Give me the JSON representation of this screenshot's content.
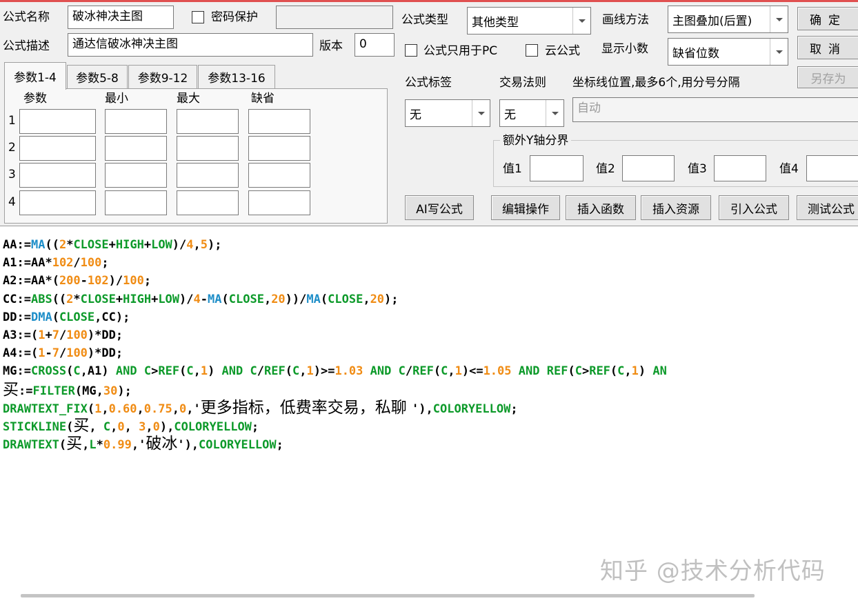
{
  "header": {
    "name_label": "公式名称",
    "name_value": "破冰神决主图",
    "password_label": "密码保护",
    "desc_label": "公式描述",
    "desc_value": "通达信破冰神决主图",
    "version_label": "版本",
    "version_value": "0",
    "type_label": "公式类型",
    "type_value": "其他类型",
    "draw_label": "画线方法",
    "draw_value": "主图叠加(后置)",
    "pc_only_label": "公式只用于PC",
    "cloud_label": "云公式",
    "decimals_label": "显示小数",
    "decimals_value": "缺省位数"
  },
  "buttons": {
    "ok": "确定",
    "cancel": "取消",
    "save_as": "另存为",
    "ai_write": "AI写公式",
    "edit_ops": "编辑操作",
    "insert_func": "插入函数",
    "insert_res": "插入资源",
    "import_formula": "引入公式",
    "test_formula": "测试公式"
  },
  "tabs": [
    {
      "label": "参数1-4",
      "active": true
    },
    {
      "label": "参数5-8",
      "active": false
    },
    {
      "label": "参数9-12",
      "active": false
    },
    {
      "label": "参数13-16",
      "active": false
    }
  ],
  "params": {
    "headers": [
      "参数",
      "最小",
      "最大",
      "缺省"
    ],
    "rows": [
      "1",
      "2",
      "3",
      "4"
    ]
  },
  "right_panel": {
    "tag_label": "公式标签",
    "tag_value": "无",
    "rule_label": "交易法则",
    "rule_value": "无",
    "axis_label": "坐标线位置,最多6个,用分号分隔",
    "axis_value": "自动",
    "extra_y_title": "额外Y轴分界",
    "val1_label": "值1",
    "val2_label": "值2",
    "val3_label": "值3",
    "val4_label": "值4"
  },
  "code_lines": [
    [
      [
        "var",
        "AA"
      ],
      [
        "op",
        ":="
      ],
      [
        "fn",
        "MA"
      ],
      [
        "op",
        "(("
      ],
      [
        "num",
        "2"
      ],
      [
        "op",
        "*"
      ],
      [
        "kw",
        "CLOSE"
      ],
      [
        "op",
        "+"
      ],
      [
        "kw",
        "HIGH"
      ],
      [
        "op",
        "+"
      ],
      [
        "kw",
        "LOW"
      ],
      [
        "op",
        ")/"
      ],
      [
        "num",
        "4"
      ],
      [
        "op",
        ","
      ],
      [
        "num",
        "5"
      ],
      [
        "op",
        ");"
      ]
    ],
    [
      [
        "var",
        "A1"
      ],
      [
        "op",
        ":="
      ],
      [
        "var",
        "AA"
      ],
      [
        "op",
        "*"
      ],
      [
        "num",
        "102"
      ],
      [
        "op",
        "/"
      ],
      [
        "num",
        "100"
      ],
      [
        "op",
        ";"
      ]
    ],
    [
      [
        "var",
        "A2"
      ],
      [
        "op",
        ":="
      ],
      [
        "var",
        "AA"
      ],
      [
        "op",
        "*("
      ],
      [
        "num",
        "200"
      ],
      [
        "op",
        "-"
      ],
      [
        "num",
        "102"
      ],
      [
        "op",
        ")/"
      ],
      [
        "num",
        "100"
      ],
      [
        "op",
        ";"
      ]
    ],
    [
      [
        "var",
        "CC"
      ],
      [
        "op",
        ":="
      ],
      [
        "kw",
        "ABS"
      ],
      [
        "op",
        "(("
      ],
      [
        "num",
        "2"
      ],
      [
        "op",
        "*"
      ],
      [
        "kw",
        "CLOSE"
      ],
      [
        "op",
        "+"
      ],
      [
        "kw",
        "HIGH"
      ],
      [
        "op",
        "+"
      ],
      [
        "kw",
        "LOW"
      ],
      [
        "op",
        ")/"
      ],
      [
        "num",
        "4"
      ],
      [
        "op",
        "-"
      ],
      [
        "fn",
        "MA"
      ],
      [
        "op",
        "("
      ],
      [
        "kw",
        "CLOSE"
      ],
      [
        "op",
        ","
      ],
      [
        "num",
        "20"
      ],
      [
        "op",
        "))/"
      ],
      [
        "fn",
        "MA"
      ],
      [
        "op",
        "("
      ],
      [
        "kw",
        "CLOSE"
      ],
      [
        "op",
        ","
      ],
      [
        "num",
        "20"
      ],
      [
        "op",
        ");"
      ]
    ],
    [
      [
        "var",
        "DD"
      ],
      [
        "op",
        ":="
      ],
      [
        "fn",
        "DMA"
      ],
      [
        "op",
        "("
      ],
      [
        "kw",
        "CLOSE"
      ],
      [
        "op",
        ","
      ],
      [
        "var",
        "CC"
      ],
      [
        "op",
        ");"
      ]
    ],
    [
      [
        "var",
        "A3"
      ],
      [
        "op",
        ":=("
      ],
      [
        "num",
        "1"
      ],
      [
        "op",
        "+"
      ],
      [
        "num",
        "7"
      ],
      [
        "op",
        "/"
      ],
      [
        "num",
        "100"
      ],
      [
        "op",
        ")*"
      ],
      [
        "var",
        "DD"
      ],
      [
        "op",
        ";"
      ]
    ],
    [
      [
        "var",
        "A4"
      ],
      [
        "op",
        ":=("
      ],
      [
        "num",
        "1"
      ],
      [
        "op",
        "-"
      ],
      [
        "num",
        "7"
      ],
      [
        "op",
        "/"
      ],
      [
        "num",
        "100"
      ],
      [
        "op",
        ")*"
      ],
      [
        "var",
        "DD"
      ],
      [
        "op",
        ";"
      ]
    ],
    [
      [
        "var",
        "MG"
      ],
      [
        "op",
        ":="
      ],
      [
        "kw",
        "CROSS"
      ],
      [
        "op",
        "("
      ],
      [
        "kw",
        "C"
      ],
      [
        "op",
        ","
      ],
      [
        "var",
        "A1"
      ],
      [
        "op",
        ") "
      ],
      [
        "kw",
        "AND"
      ],
      [
        "op",
        " "
      ],
      [
        "kw",
        "C"
      ],
      [
        "op",
        ">"
      ],
      [
        "kw",
        "REF"
      ],
      [
        "op",
        "("
      ],
      [
        "kw",
        "C"
      ],
      [
        "op",
        ","
      ],
      [
        "num",
        "1"
      ],
      [
        "op",
        ") "
      ],
      [
        "kw",
        "AND"
      ],
      [
        "op",
        " "
      ],
      [
        "kw",
        "C"
      ],
      [
        "op",
        "/"
      ],
      [
        "kw",
        "REF"
      ],
      [
        "op",
        "("
      ],
      [
        "kw",
        "C"
      ],
      [
        "op",
        ","
      ],
      [
        "num",
        "1"
      ],
      [
        "op",
        ")>="
      ],
      [
        "num",
        "1.03"
      ],
      [
        "op",
        " "
      ],
      [
        "kw",
        "AND"
      ],
      [
        "op",
        " "
      ],
      [
        "kw",
        "C"
      ],
      [
        "op",
        "/"
      ],
      [
        "kw",
        "REF"
      ],
      [
        "op",
        "("
      ],
      [
        "kw",
        "C"
      ],
      [
        "op",
        ","
      ],
      [
        "num",
        "1"
      ],
      [
        "op",
        ")<="
      ],
      [
        "num",
        "1.05"
      ],
      [
        "op",
        " "
      ],
      [
        "kw",
        "AND"
      ],
      [
        "op",
        " "
      ],
      [
        "kw",
        "REF"
      ],
      [
        "op",
        "("
      ],
      [
        "kw",
        "C"
      ],
      [
        "op",
        ">"
      ],
      [
        "kw",
        "REF"
      ],
      [
        "op",
        "("
      ],
      [
        "kw",
        "C"
      ],
      [
        "op",
        ","
      ],
      [
        "num",
        "1"
      ],
      [
        "op",
        ") "
      ],
      [
        "kw",
        "AN"
      ]
    ],
    [
      [
        "cjk",
        "买"
      ],
      [
        "op",
        ":="
      ],
      [
        "kw",
        "FILTER"
      ],
      [
        "op",
        "("
      ],
      [
        "var",
        "MG"
      ],
      [
        "op",
        ","
      ],
      [
        "num",
        "30"
      ],
      [
        "op",
        ");"
      ]
    ],
    [
      [
        "kw",
        "DRAWTEXT_FIX"
      ],
      [
        "op",
        "("
      ],
      [
        "num",
        "1"
      ],
      [
        "op",
        ","
      ],
      [
        "num",
        "0.60"
      ],
      [
        "op",
        ","
      ],
      [
        "num",
        "0.75"
      ],
      [
        "op",
        ","
      ],
      [
        "num",
        "0"
      ],
      [
        "op",
        ",'"
      ],
      [
        "cjk",
        "更多指标，低费率交易，私聊 "
      ],
      [
        "op",
        "'),"
      ],
      [
        "kw",
        "COLORYELLOW"
      ],
      [
        "op",
        ";"
      ]
    ],
    [
      [
        "kw",
        "STICKLINE"
      ],
      [
        "op",
        "("
      ],
      [
        "cjk",
        "买"
      ],
      [
        "op",
        ", "
      ],
      [
        "kw",
        "C"
      ],
      [
        "op",
        ","
      ],
      [
        "num",
        "0"
      ],
      [
        "op",
        ", "
      ],
      [
        "num",
        "3"
      ],
      [
        "op",
        ","
      ],
      [
        "num",
        "0"
      ],
      [
        "op",
        "),"
      ],
      [
        "kw",
        "COLORYELLOW"
      ],
      [
        "op",
        ";"
      ]
    ],
    [
      [
        "kw",
        "DRAWTEXT"
      ],
      [
        "op",
        "("
      ],
      [
        "cjk",
        "买"
      ],
      [
        "op",
        ","
      ],
      [
        "kw",
        "L"
      ],
      [
        "op",
        "*"
      ],
      [
        "num",
        "0.99"
      ],
      [
        "op",
        ",'"
      ],
      [
        "cjk",
        "破冰"
      ],
      [
        "op",
        "'),"
      ],
      [
        "kw",
        "COLORYELLOW"
      ],
      [
        "op",
        ";"
      ]
    ]
  ],
  "watermark": "知乎 @技术分析代码"
}
